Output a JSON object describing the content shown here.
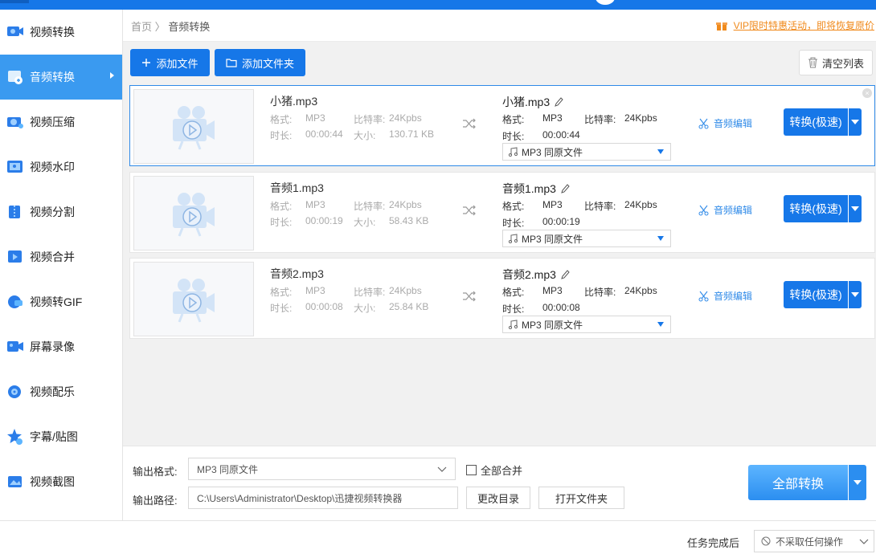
{
  "sidebar": {
    "items": [
      {
        "label": "视频转换",
        "icon": "video-convert-icon"
      },
      {
        "label": "音频转换",
        "icon": "audio-convert-icon",
        "active": true
      },
      {
        "label": "视频压缩",
        "icon": "video-compress-icon"
      },
      {
        "label": "视频水印",
        "icon": "video-watermark-icon"
      },
      {
        "label": "视频分割",
        "icon": "video-split-icon"
      },
      {
        "label": "视频合并",
        "icon": "video-merge-icon"
      },
      {
        "label": "视频转GIF",
        "icon": "video-gif-icon"
      },
      {
        "label": "屏幕录像",
        "icon": "screen-record-icon"
      },
      {
        "label": "视频配乐",
        "icon": "video-music-icon"
      },
      {
        "label": "字幕/贴图",
        "icon": "subtitle-sticker-icon"
      },
      {
        "label": "视频截图",
        "icon": "video-screenshot-icon"
      }
    ]
  },
  "breadcrumb": {
    "home": "首页",
    "sep": "〉",
    "current": "音频转换"
  },
  "vip": {
    "text": "VIP限时特惠活动，即将恢复原价"
  },
  "toolbar": {
    "add_file": "添加文件",
    "add_folder": "添加文件夹",
    "clear_list": "清空列表"
  },
  "labels": {
    "format": "格式:",
    "bitrate": "比特率:",
    "duration": "时长:",
    "size": "大小:",
    "audio_edit": "音频编辑",
    "convert": "转换(极速)"
  },
  "files": [
    {
      "name": "小猪.mp3",
      "format": "MP3",
      "bitrate": "24Kpbs",
      "duration": "00:00:44",
      "size": "130.71 KB",
      "out_name": "小猪.mp3",
      "out_format": "MP3",
      "out_bitrate": "24Kpbs",
      "out_duration": "00:00:44",
      "out_select": "MP3   同原文件"
    },
    {
      "name": "音频1.mp3",
      "format": "MP3",
      "bitrate": "24Kpbs",
      "duration": "00:00:19",
      "size": "58.43 KB",
      "out_name": "音频1.mp3",
      "out_format": "MP3",
      "out_bitrate": "24Kpbs",
      "out_duration": "00:00:19",
      "out_select": "MP3   同原文件"
    },
    {
      "name": "音频2.mp3",
      "format": "MP3",
      "bitrate": "24Kpbs",
      "duration": "00:00:08",
      "size": "25.84 KB",
      "out_name": "音频2.mp3",
      "out_format": "MP3",
      "out_bitrate": "24Kpbs",
      "out_duration": "00:00:08",
      "out_select": "MP3   同原文件"
    }
  ],
  "output": {
    "format_label": "输出格式:",
    "format_value": "MP3   同原文件",
    "merge_all": "全部合并",
    "path_label": "输出路径:",
    "path_value": "C:\\Users\\Administrator\\Desktop\\迅捷视频转换器",
    "change_dir": "更改目录",
    "open_folder": "打开文件夹",
    "convert_all": "全部转换"
  },
  "status": {
    "after_label": "任务完成后",
    "after_value": "不采取任何操作"
  },
  "colors": {
    "primary": "#1677e8",
    "active_nav": "#3a9af0",
    "vip": "#f08a1c"
  }
}
